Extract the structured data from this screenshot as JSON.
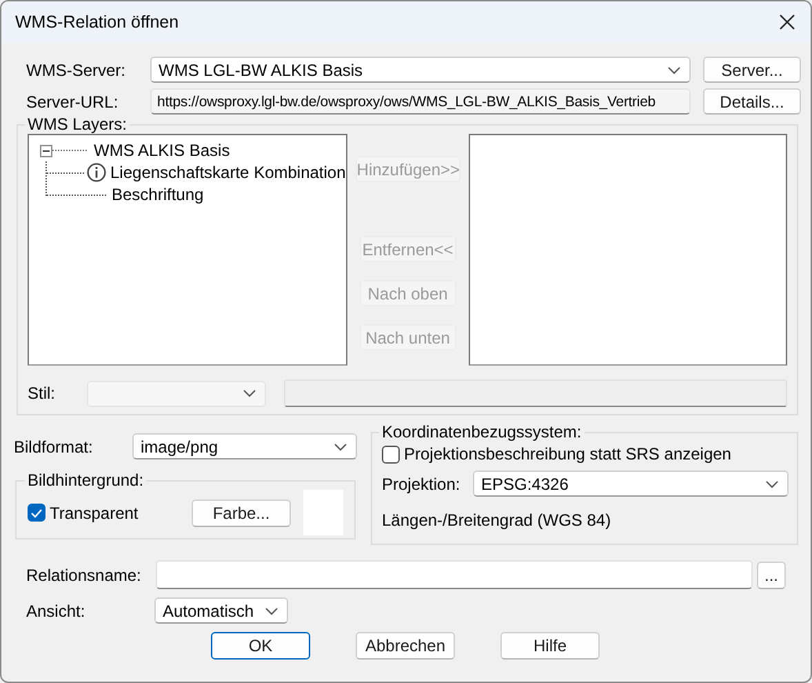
{
  "window": {
    "title": "WMS-Relation öffnen"
  },
  "server": {
    "label": "WMS-Server:",
    "value": "WMS LGL-BW ALKIS Basis",
    "button": "Server..."
  },
  "server_url": {
    "label": "Server-URL:",
    "value": "https://owsproxy.lgl-bw.de/owsproxy/ows/WMS_LGL-BW_ALKIS_Basis_Vertrieb",
    "button": "Details..."
  },
  "wms_layers": {
    "label": "WMS Layers:",
    "tree": [
      {
        "label": "WMS ALKIS Basis",
        "expanded": true,
        "children": [
          {
            "label": "Liegenschaftskarte Kombination",
            "kind": "info"
          },
          {
            "label": "Beschriftung",
            "kind": "plain"
          }
        ]
      }
    ],
    "buttons": [
      {
        "label": "Hinzufügen>>",
        "disabled": true
      },
      {
        "label": "Entfernen<<",
        "disabled": true
      },
      {
        "label": "Nach oben",
        "disabled": true
      },
      {
        "label": "Nach unten",
        "disabled": true
      }
    ],
    "style": {
      "label": "Stil:",
      "disabled": true
    }
  },
  "image_format": {
    "label": "Bildformat:",
    "value": "image/png"
  },
  "background": {
    "label": "Bildhintergrund:",
    "transparent": {
      "label": "Transparent",
      "checked": true
    },
    "button": "Farbe..."
  },
  "crs": {
    "label": "Koordinatenbezugssystem:",
    "show_description": {
      "label": "Projektionsbeschreibung statt SRS anzeigen",
      "checked": false
    },
    "projection": {
      "label": "Projektion:",
      "value": "EPSG:4326"
    },
    "description": "Längen-/Breitengrad (WGS 84)"
  },
  "relation_name": {
    "label": "Relationsname:",
    "browse": "..."
  },
  "view": {
    "label": "Ansicht:",
    "value": "Automatisch"
  },
  "dialog_buttons": [
    {
      "label": "OK",
      "default": true
    },
    {
      "label": "Abbrechen",
      "default": false
    },
    {
      "label": "Hilfe",
      "default": false
    }
  ]
}
